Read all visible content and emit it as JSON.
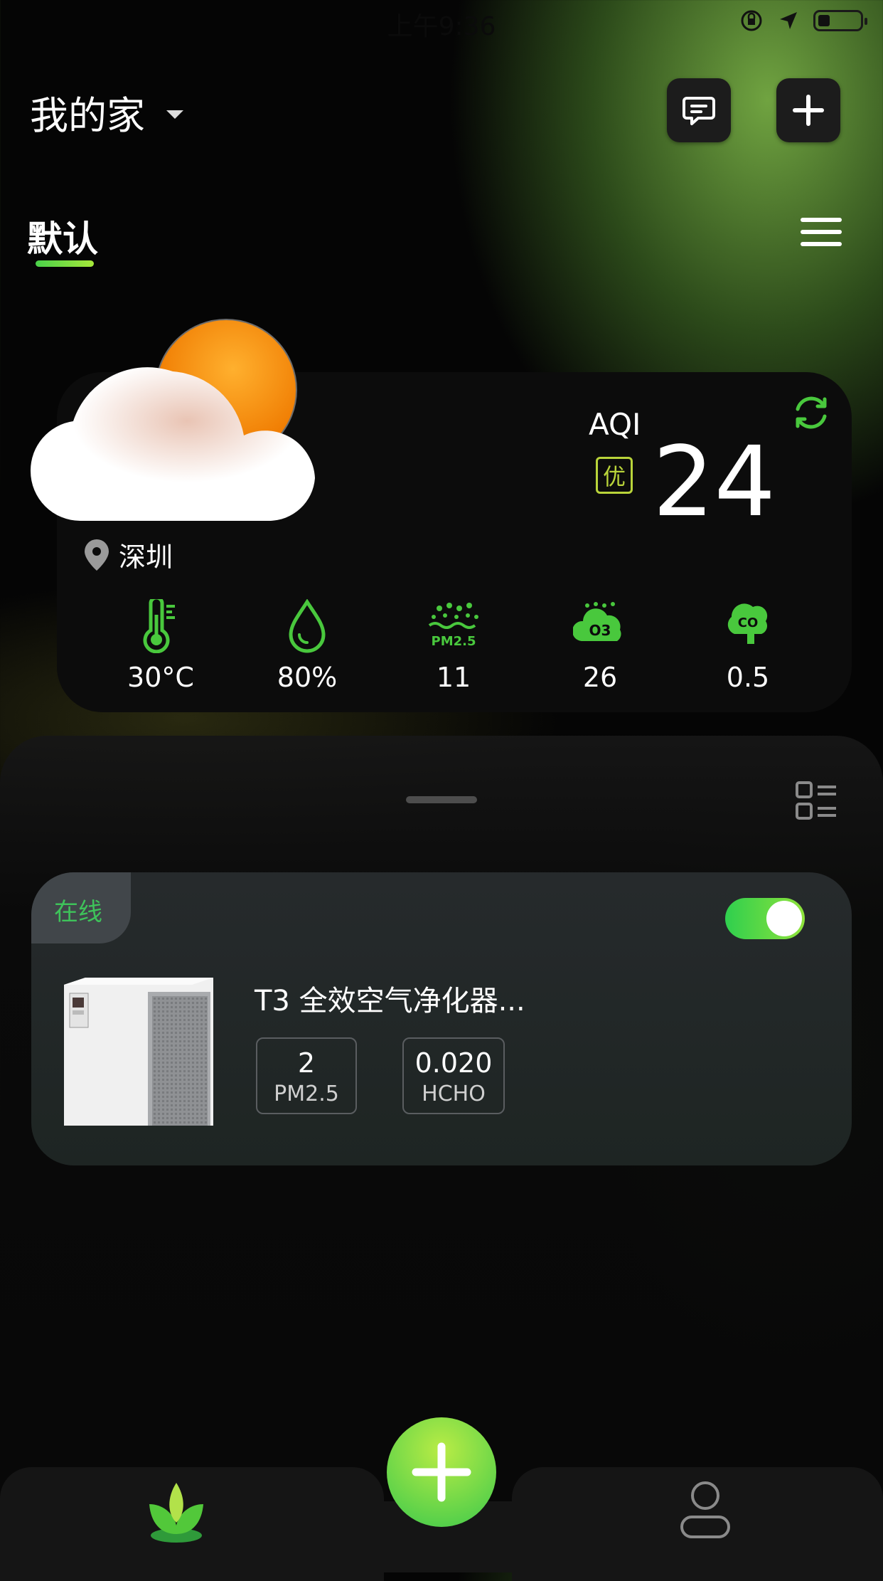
{
  "status_bar": {
    "time": "上午9:36"
  },
  "header": {
    "home_name": "我的家"
  },
  "tabs": {
    "active_label": "默认"
  },
  "weather": {
    "location": "深圳",
    "aqi_label": "AQI",
    "aqi_level": "优",
    "aqi_value": "24",
    "metrics": [
      {
        "name": "temperature",
        "value": "30°C"
      },
      {
        "name": "humidity",
        "value": "80%"
      },
      {
        "name": "pm25",
        "value": "11",
        "icon_text": "PM2.5"
      },
      {
        "name": "ozone",
        "value": "26",
        "icon_text": "O3"
      },
      {
        "name": "co",
        "value": "0.5",
        "icon_text": "CO"
      }
    ]
  },
  "device": {
    "status": "在线",
    "name": "T3 全效空气净化器...",
    "power_on": true,
    "stats": [
      {
        "value": "2",
        "label": "PM2.5"
      },
      {
        "value": "0.020",
        "label": "HCHO"
      }
    ]
  },
  "colors": {
    "accent_green": "#4ad24a",
    "aqi_good": "#b9d43a"
  }
}
